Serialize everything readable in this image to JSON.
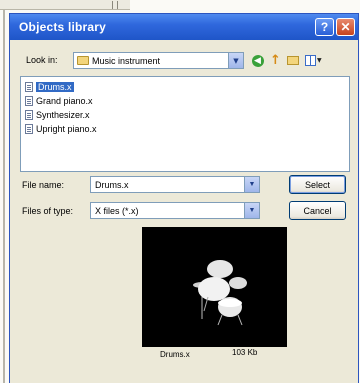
{
  "window": {
    "title": "Objects library",
    "help_glyph": "?",
    "close_glyph": "✕"
  },
  "look_in": {
    "label": "Look in:",
    "value": "Music instrument",
    "icon": "folder-icon"
  },
  "toolbar": {
    "back_icon": "back-arrow-icon",
    "up_icon": "up-folder-icon",
    "new_folder_icon": "new-folder-icon",
    "views_icon": "views-menu-icon"
  },
  "files": [
    {
      "name": "Drums.x",
      "selected": true
    },
    {
      "name": "Grand piano.x",
      "selected": false
    },
    {
      "name": "Synthesizer.x",
      "selected": false
    },
    {
      "name": "Upright piano.x",
      "selected": false
    }
  ],
  "file_name": {
    "label": "File name:",
    "value": "Drums.x"
  },
  "file_type": {
    "label": "Files of type:",
    "value": "X files (*.x)"
  },
  "buttons": {
    "select": "Select",
    "cancel": "Cancel"
  },
  "preview": {
    "name": "Drums.x",
    "size": "103 Kb"
  },
  "colors": {
    "titlebar": "#2f68dd",
    "dialog_bg": "#ece9d8",
    "selection": "#316ac5",
    "preview_bg": "#000000"
  }
}
